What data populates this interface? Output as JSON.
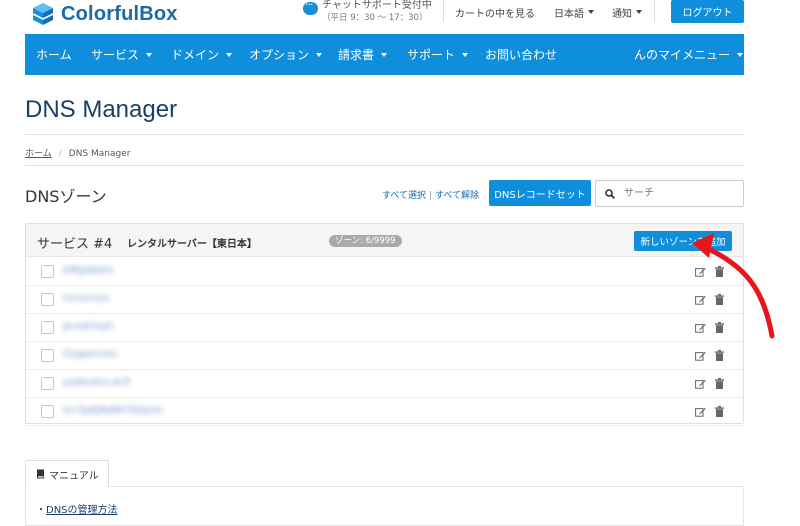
{
  "brand": {
    "name": "ColorfulBox"
  },
  "chat": {
    "label": "チャットサポート受付中",
    "hours": "（平日 9：30 ～ 17：30）"
  },
  "top_links": {
    "cart": "カートの中を見る",
    "language": "日本語",
    "notifications": "通知",
    "logout": "ログアウト"
  },
  "nav": {
    "items": [
      {
        "label": "ホーム"
      },
      {
        "label": "サービス"
      },
      {
        "label": "ドメイン"
      },
      {
        "label": "オプション"
      },
      {
        "label": "請求書"
      },
      {
        "label": "サポート"
      },
      {
        "label": "お問い合わせ"
      }
    ],
    "my_menu": "んのマイメニュー"
  },
  "page": {
    "title": "DNS Manager"
  },
  "breadcrumb": {
    "home": "ホーム",
    "current": "DNS Manager"
  },
  "zones": {
    "heading": "DNSゾーン",
    "select_all": "すべて選択",
    "deselect_all": "すべて解除",
    "dns_record_set_label": "DNSレコードセット",
    "search_placeholder": "サーチ"
  },
  "service": {
    "number": "サービス #4",
    "name": "レンタルサーバー【東日本】",
    "zone_count": "ゾーン: 6/9999",
    "add_zone_label": "新しいゾーンを追加"
  },
  "zone_rows": [
    {
      "name": "k9fg4pbm"
    },
    {
      "name": "h1nxrvzo"
    },
    {
      "name": "pcxdcloyh"
    },
    {
      "name": "f1qwerrvei"
    },
    {
      "name": "yodevkm.dcfi"
    },
    {
      "name": "ev-5p6j8d8h7kjlytm"
    }
  ],
  "manual": {
    "tab_label": "マニュアル",
    "link": "DNSの管理方法"
  },
  "colors": {
    "primary": "#0f8fdb",
    "title": "#1b3f66",
    "arrow": "#e8161b"
  }
}
